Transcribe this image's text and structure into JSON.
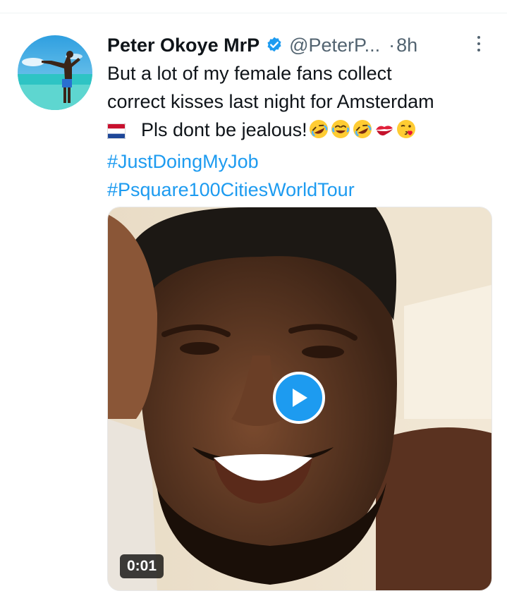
{
  "tweet": {
    "display_name": "Peter Okoye MrP",
    "handle": "@PeterP...",
    "separator": "·",
    "time": "8h",
    "verified": true,
    "verified_color": "#1d9bf0",
    "text_line_1": "But a lot of my female fans collect",
    "text_line_2": "correct kisses last night for Amsterdam",
    "text_line_3": "Pls dont be jealous!",
    "flag_icon": "netherlands-flag-icon",
    "emojis": [
      "rolling-on-floor-laughing-emoji",
      "tears-of-joy-emoji",
      "rolling-on-floor-laughing-emoji",
      "kiss-mark-emoji",
      "face-blowing-kiss-emoji"
    ],
    "hashtags": [
      "#JustDoingMyJob",
      "#Psquare100CitiesWorldTour"
    ],
    "hashtag_color": "#1d9bf0"
  },
  "media": {
    "type": "video",
    "duration": "0:01",
    "play_icon": "play-icon"
  }
}
